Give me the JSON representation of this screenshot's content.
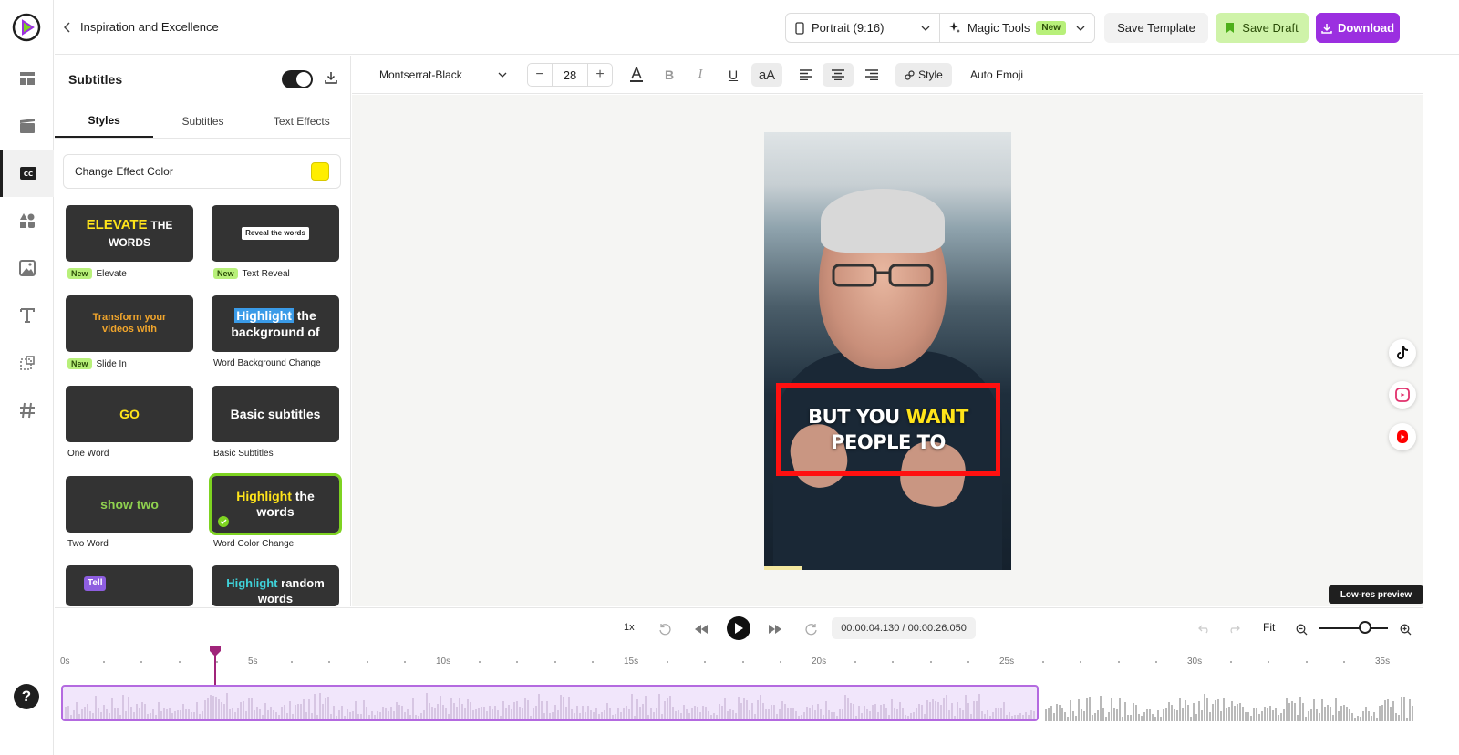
{
  "topbar": {
    "project_title": "Inspiration and Excellence",
    "aspect_ratio": "Portrait (9:16)",
    "magic_tools": "Magic Tools",
    "magic_badge": "New",
    "save_template": "Save Template",
    "save_draft": "Save Draft",
    "download": "Download"
  },
  "rail": {
    "items": [
      "layout-icon",
      "media-icon",
      "subtitles-icon",
      "elements-icon",
      "images-icon",
      "text-icon",
      "transform-icon",
      "hashtag-icon"
    ],
    "active": "subtitles-icon",
    "help": "?"
  },
  "panel": {
    "title": "Subtitles",
    "tabs": [
      "Styles",
      "Subtitles",
      "Text Effects"
    ],
    "active_tab": "Styles",
    "effect_color_label": "Change Effect Color",
    "effect_color": "#ffee00",
    "cards": [
      {
        "preview_a": "ELEVATE",
        "preview_b": "THE WORDS",
        "label": "Elevate",
        "badge": "New"
      },
      {
        "preview": "Reveal the words",
        "label": "Text Reveal",
        "badge": "New"
      },
      {
        "preview": "Transform your videos with",
        "label": "Slide In",
        "badge": "New"
      },
      {
        "preview_a": "Highlight",
        "preview_b": "the background of",
        "label": "Word Background Change"
      },
      {
        "preview": "GO",
        "label": "One Word"
      },
      {
        "preview": "Basic subtitles",
        "label": "Basic Subtitles"
      },
      {
        "preview": "show two",
        "label": "Two Word"
      },
      {
        "preview_a": "Highlight",
        "preview_b": "the words",
        "label": "Word Color Change",
        "selected": true
      },
      {
        "preview": "Tell",
        "label": ""
      },
      {
        "preview_a": "Highlight",
        "preview_b": "random words",
        "label": ""
      }
    ]
  },
  "toolbar": {
    "font": "Montserrat-Black",
    "font_size": "28",
    "style": "Style",
    "auto_emoji": "Auto Emoji"
  },
  "canvas": {
    "caption_a": "BUT YOU",
    "caption_b": "WANT",
    "caption_c": "PEOPLE TO",
    "lowres": "Low-res preview"
  },
  "timeline": {
    "speed": "1x",
    "timecode": "00:00:04.130 / 00:00:26.050",
    "fit": "Fit",
    "ticks": [
      "0s",
      "5s",
      "10s",
      "15s",
      "20s",
      "25s",
      "30s",
      "35s"
    ],
    "current_time_s": 4.13,
    "duration_s": 26.05
  }
}
